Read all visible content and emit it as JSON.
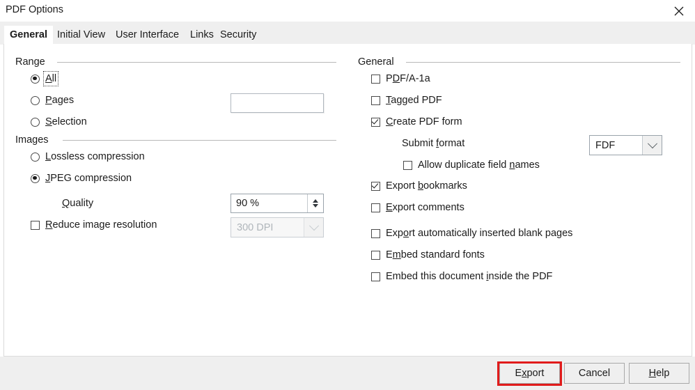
{
  "window": {
    "title": "PDF Options",
    "close_icon": "close-icon"
  },
  "tabs": [
    {
      "label": "General",
      "active": true
    },
    {
      "label": "Initial View",
      "active": false
    },
    {
      "label": "User Interface",
      "active": false
    },
    {
      "label": "Links",
      "active": false
    },
    {
      "label": "Security",
      "active": false
    }
  ],
  "left": {
    "range": {
      "title": "Range",
      "options": [
        {
          "label": "All",
          "mnemonic": "A",
          "checked": true,
          "focused": true
        },
        {
          "label": "Pages",
          "mnemonic": "P",
          "checked": false,
          "focused": false
        },
        {
          "label": "Selection",
          "mnemonic": "S",
          "checked": false,
          "focused": false
        }
      ],
      "pages_field_value": "",
      "pages_field_placeholder": ""
    },
    "images": {
      "title": "Images",
      "options": [
        {
          "label": "Lossless compression",
          "mnemonic": "L",
          "checked": false
        },
        {
          "label": "JPEG compression",
          "mnemonic": "J",
          "checked": true
        }
      ],
      "quality_label": "Quality",
      "quality_mnemonic": "Q",
      "quality_value": "90 %",
      "reduce_label": "Reduce image resolution",
      "reduce_mnemonic": "R",
      "reduce_checked": false,
      "dpi_value": "300 DPI",
      "dpi_disabled": true
    }
  },
  "right": {
    "title": "General",
    "options": [
      {
        "label": "PDF/A-1a",
        "mnemonic": "D",
        "checked": false,
        "indent": 0
      },
      {
        "label": "Tagged PDF",
        "mnemonic": "T",
        "checked": false,
        "indent": 0
      },
      {
        "label": "Create PDF form",
        "mnemonic": "C",
        "checked": true,
        "indent": 0
      },
      {
        "label": "Allow duplicate field names",
        "mnemonic": "n",
        "checked": false,
        "indent": 1
      },
      {
        "label": "Export bookmarks",
        "mnemonic": "b",
        "checked": true,
        "indent": 0
      },
      {
        "label": "Export comments",
        "mnemonic": "E",
        "checked": false,
        "indent": 0
      },
      {
        "label": "Export automatically inserted blank pages",
        "mnemonic": "o",
        "checked": false,
        "indent": 0
      },
      {
        "label": "Embed standard fonts",
        "mnemonic": "m",
        "checked": false,
        "indent": 0
      },
      {
        "label": "Embed this document inside the PDF",
        "mnemonic": "i",
        "checked": false,
        "indent": 0
      }
    ],
    "submit_format_label": "Submit format",
    "submit_format_mnemonic": "f",
    "submit_format_value": "FDF"
  },
  "buttons": {
    "export": {
      "label": "Export",
      "mnemonic": "x",
      "highlighted": true
    },
    "cancel": {
      "label": "Cancel",
      "mnemonic": ""
    },
    "help": {
      "label": "Help",
      "mnemonic": "H"
    }
  },
  "colors": {
    "highlight": "#e11b1b",
    "panel_bg": "#ffffff",
    "chrome_bg": "#efefef"
  }
}
